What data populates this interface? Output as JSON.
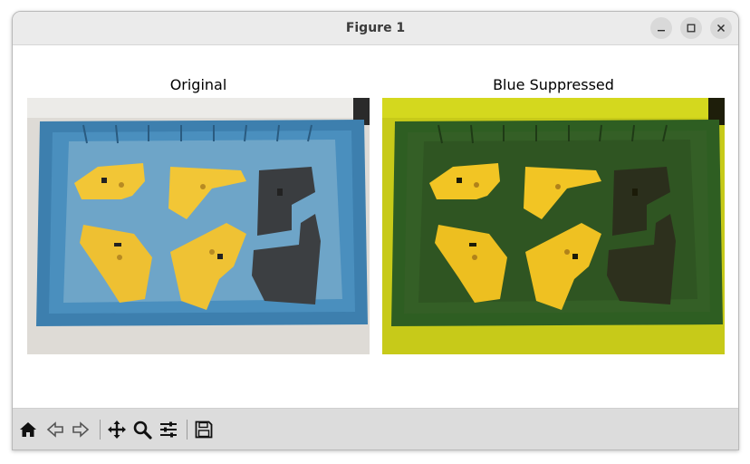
{
  "window": {
    "title": "Figure 1"
  },
  "figure": {
    "left_axes": {
      "title": "Original"
    },
    "right_axes": {
      "title": "Blue Suppressed"
    }
  },
  "toolbar": {
    "buttons": [
      {
        "name": "home-icon"
      },
      {
        "name": "back-icon"
      },
      {
        "name": "forward-icon"
      },
      {
        "name": "pan-icon"
      },
      {
        "name": "zoom-icon"
      },
      {
        "name": "configure-subplots-icon"
      },
      {
        "name": "save-icon"
      }
    ]
  },
  "colors": {
    "crate_blue": "#3f7fae",
    "part_yellow": "#f2c636",
    "part_dark": "#3a3d40",
    "filtered_bg": "#c9cc1a",
    "filtered_crate": "#2f5a22"
  }
}
